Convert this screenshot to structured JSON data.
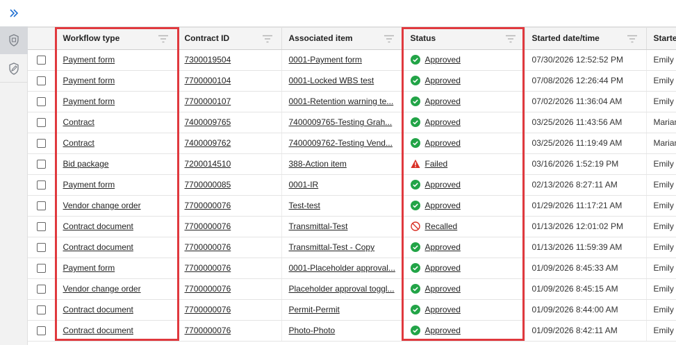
{
  "columns": [
    {
      "label": "Workflow type"
    },
    {
      "label": "Contract ID"
    },
    {
      "label": "Associated item"
    },
    {
      "label": "Status"
    },
    {
      "label": "Started date/time"
    },
    {
      "label": "Starte"
    }
  ],
  "rows": [
    {
      "workflow": "Payment form",
      "contract": "7300019504",
      "item": "0001-Payment form",
      "status": "Approved",
      "status_icon": "approved-check-icon",
      "started": "07/30/2026 12:52:52 PM",
      "by": "Emily"
    },
    {
      "workflow": "Payment form",
      "contract": "7700000104",
      "item": "0001-Locked WBS test",
      "status": "Approved",
      "status_icon": "approved-check-icon",
      "started": "07/08/2026 12:26:44 PM",
      "by": "Emily"
    },
    {
      "workflow": "Payment form",
      "contract": "7700000107",
      "item": "0001-Retention warning te...",
      "status": "Approved",
      "status_icon": "approved-check-icon",
      "started": "07/02/2026 11:36:04 AM",
      "by": "Emily"
    },
    {
      "workflow": "Contract",
      "contract": "7400009765",
      "item": "7400009765-Testing Grah...",
      "status": "Approved",
      "status_icon": "approved-check-icon",
      "started": "03/25/2026 11:43:56 AM",
      "by": "Marian"
    },
    {
      "workflow": "Contract",
      "contract": "7400009762",
      "item": "7400009762-Testing Vend...",
      "status": "Approved",
      "status_icon": "approved-check-icon",
      "started": "03/25/2026 11:19:49 AM",
      "by": "Marian"
    },
    {
      "workflow": "Bid package",
      "contract": "7200014510",
      "item": "388-Action item",
      "status": "Failed",
      "status_icon": "failed-warning-icon",
      "started": "03/16/2026 1:52:19 PM",
      "by": "Emily"
    },
    {
      "workflow": "Payment form",
      "contract": "7700000085",
      "item": "0001-IR",
      "status": "Approved",
      "status_icon": "approved-check-icon",
      "started": "02/13/2026 8:27:11 AM",
      "by": "Emily"
    },
    {
      "workflow": "Vendor change order",
      "contract": "7700000076",
      "item": "Test-test",
      "status": "Approved",
      "status_icon": "approved-check-icon",
      "started": "01/29/2026 11:17:21 AM",
      "by": "Emily"
    },
    {
      "workflow": "Contract document",
      "contract": "7700000076",
      "item": "Transmittal-Test",
      "status": "Recalled",
      "status_icon": "recalled-circle-icon",
      "started": "01/13/2026 12:01:02 PM",
      "by": "Emily"
    },
    {
      "workflow": "Contract document",
      "contract": "7700000076",
      "item": "Transmittal-Test - Copy",
      "status": "Approved",
      "status_icon": "approved-check-icon",
      "started": "01/13/2026 11:59:39 AM",
      "by": "Emily"
    },
    {
      "workflow": "Payment form",
      "contract": "7700000076",
      "item": "0001-Placeholder approval...",
      "status": "Approved",
      "status_icon": "approved-check-icon",
      "started": "01/09/2026 8:45:33 AM",
      "by": "Emily"
    },
    {
      "workflow": "Vendor change order",
      "contract": "7700000076",
      "item": "Placeholder approval toggl...",
      "status": "Approved",
      "status_icon": "approved-check-icon",
      "started": "01/09/2026 8:45:15 AM",
      "by": "Emily"
    },
    {
      "workflow": "Contract document",
      "contract": "7700000076",
      "item": "Permit-Permit",
      "status": "Approved",
      "status_icon": "approved-check-icon",
      "started": "01/09/2026 8:44:00 AM",
      "by": "Emily"
    },
    {
      "workflow": "Contract document",
      "contract": "7700000076",
      "item": "Photo-Photo",
      "status": "Approved",
      "status_icon": "approved-check-icon",
      "started": "01/09/2026 8:42:11 AM",
      "by": "Emily"
    }
  ],
  "colors": {
    "approved": "#22a447",
    "failed": "#d93025",
    "recalled": "#d93025",
    "highlight": "#e0393e",
    "accent": "#1f6fd1"
  },
  "icons": {
    "rail_expand": "double-chevron-right-icon",
    "rail_item_1": "workflow-shield-icon",
    "rail_item_2": "edit-doc-icon",
    "column_filter": "filter-lines-icon"
  }
}
